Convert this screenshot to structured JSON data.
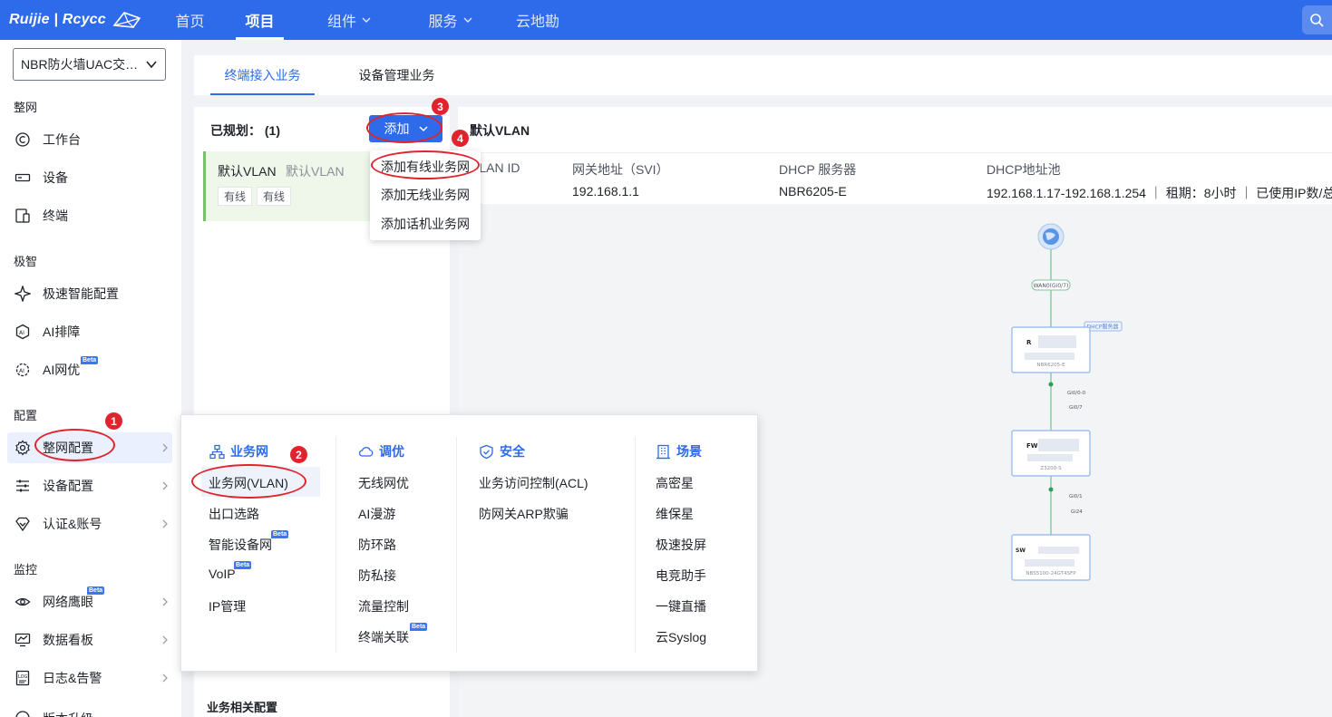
{
  "topbar": {
    "brand": "Ruijie | Rcycc",
    "nav": [
      {
        "label": "首页"
      },
      {
        "label": "项目"
      },
      {
        "label": "组件"
      },
      {
        "label": "服务"
      },
      {
        "label": "云地勘"
      }
    ]
  },
  "sidebar": {
    "project": "NBR防火墙UAC交…",
    "groups": {
      "g1": "整网",
      "g2": "极智",
      "g3": "配置",
      "g4": "监控"
    },
    "items": {
      "workbench": "工作台",
      "devices": "设备",
      "terminals": "终端",
      "fast_config": "极速智能配置",
      "ai_diagnose": "AI排障",
      "ai_optimize": "AI网优",
      "network_config": "整网配置",
      "device_config": "设备配置",
      "auth_account": "认证&账号",
      "network_eye": "网络鹰眼",
      "dashboard": "数据看板",
      "logs_alarms": "日志&告警",
      "cut_off": "版本升级"
    },
    "beta": "Beta"
  },
  "tabs": {
    "terminal_access": "终端接入业务",
    "device_mgmt": "设备管理业务"
  },
  "planned": {
    "title": "已规划： (1)",
    "add_button": "添加",
    "card": {
      "name": "默认VLAN",
      "sub": "默认VLAN",
      "tags": [
        "有线",
        "有线"
      ]
    },
    "related": "业务相关配置"
  },
  "dropdown": {
    "items": [
      "添加有线业务网",
      "添加无线业务网",
      "添加话机业务网"
    ]
  },
  "detail": {
    "title": "默认VLAN",
    "fields": [
      {
        "key": "VLAN ID",
        "value": ""
      },
      {
        "key": "网关地址（SVI）",
        "value": "192.168.1.1"
      },
      {
        "key": "DHCP 服务器",
        "value": "NBR6205-E"
      },
      {
        "key": "DHCP地址池",
        "value": "192.168.1.17-192.168.1.254 ｜ 租期：8小时 ｜ 已使用IP数/总"
      }
    ]
  },
  "mega_menu": {
    "cols": [
      {
        "head": "业务网",
        "items": [
          "业务网(VLAN)",
          "出口选路",
          "智能设备网",
          "VoIP",
          "IP管理"
        ]
      },
      {
        "head": "调优",
        "items": [
          "无线网优",
          "AI漫游",
          "防环路",
          "防私接",
          "流量控制",
          "终端关联"
        ]
      },
      {
        "head": "安全",
        "items": [
          "业务访问控制(ACL)",
          "防网关ARP欺骗"
        ]
      },
      {
        "head": "场景",
        "items": [
          "高密星",
          "维保星",
          "极速投屏",
          "电竞助手",
          "一键直播",
          "云Syslog"
        ]
      }
    ]
  },
  "topology": {
    "wan_label": "WAN0(Gi0/7)",
    "dhcp_tag": "DHCP服务器",
    "router": {
      "letter": "R",
      "model": "NBR6205-E"
    },
    "router_ports": [
      "Gi0/0-0",
      "Gi0/7"
    ],
    "firewall": {
      "letter": "FW",
      "model": "Z3200-S"
    },
    "firewall_ports": [
      "Gi0/1",
      "Gi24"
    ],
    "switch": {
      "letter": "SW",
      "model": "NBS5100-24GT4SFP"
    }
  },
  "annotations": {
    "n1": "1",
    "n2": "2",
    "n3": "3",
    "n4": "4"
  },
  "colors": {
    "primary": "#2d6bea",
    "annotation_red": "#e0242d",
    "card_green": "#74c466"
  }
}
